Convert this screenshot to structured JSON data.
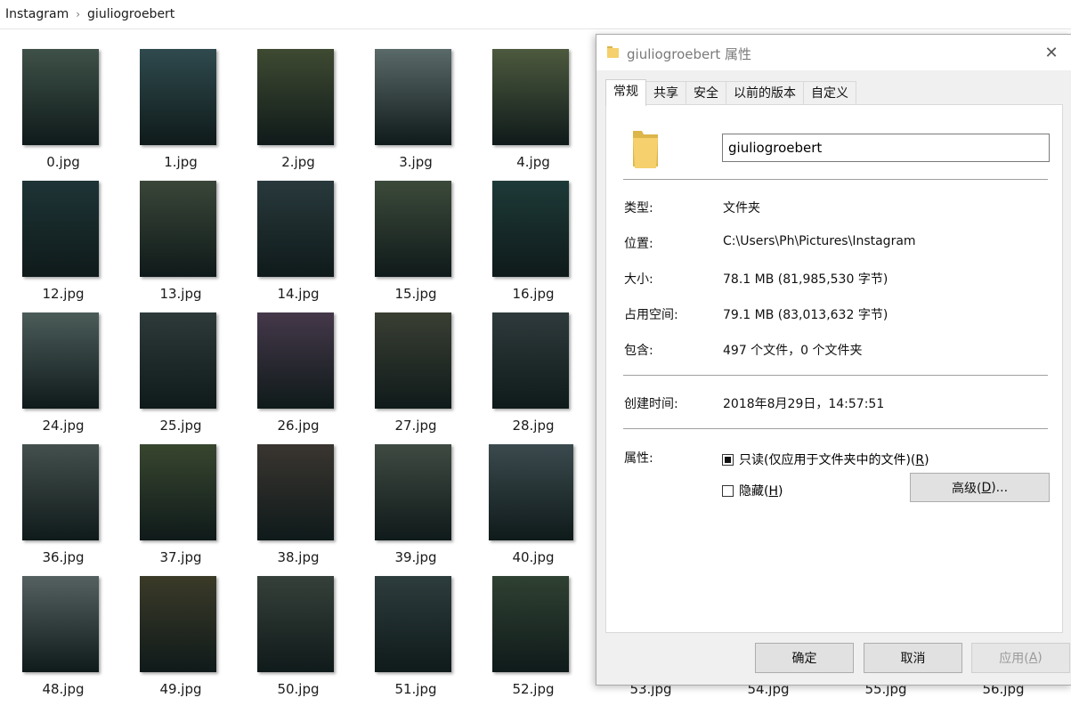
{
  "breadcrumb": {
    "items": [
      "Instagram",
      "giuliogroebert"
    ],
    "separator": "›"
  },
  "files": [
    {
      "name": "0.jpg",
      "tone": "#3e5148"
    },
    {
      "name": "1.jpg",
      "tone": "#2f4a4e"
    },
    {
      "name": "2.jpg",
      "tone": "#3f4a32"
    },
    {
      "name": "3.jpg",
      "tone": "#5a6a68"
    },
    {
      "name": "4.jpg",
      "tone": "#4d5a3e"
    },
    {
      "name": "12.jpg",
      "tone": "#1e3436"
    },
    {
      "name": "13.jpg",
      "tone": "#3a4638"
    },
    {
      "name": "14.jpg",
      "tone": "#29393c"
    },
    {
      "name": "15.jpg",
      "tone": "#3c4a3a"
    },
    {
      "name": "16.jpg",
      "tone": "#1d3a38"
    },
    {
      "name": "24.jpg",
      "tone": "#4b5c59"
    },
    {
      "name": "25.jpg",
      "tone": "#2d3a39"
    },
    {
      "name": "26.jpg",
      "tone": "#45384a"
    },
    {
      "name": "27.jpg",
      "tone": "#3a3f33"
    },
    {
      "name": "28.jpg",
      "tone": "#2e3a3b"
    },
    {
      "name": "36.jpg",
      "tone": "#44504d"
    },
    {
      "name": "37.jpg",
      "tone": "#38462f"
    },
    {
      "name": "38.jpg",
      "tone": "#3a3530"
    },
    {
      "name": "39.jpg",
      "tone": "#3f4a42"
    },
    {
      "name": "40.jpg",
      "tone": "#3b4a4e"
    },
    {
      "name": "48.jpg",
      "tone": "#556060"
    },
    {
      "name": "49.jpg",
      "tone": "#3b3a28"
    },
    {
      "name": "50.jpg",
      "tone": "#36403a"
    },
    {
      "name": "51.jpg",
      "tone": "#2d3c3d"
    },
    {
      "name": "52.jpg",
      "tone": "#2f4132"
    },
    {
      "name": "53.jpg",
      "tone": "#ffffff"
    },
    {
      "name": "54.jpg",
      "tone": "#ffffff"
    },
    {
      "name": "55.jpg",
      "tone": "#ffffff"
    },
    {
      "name": "56.jpg",
      "tone": "#ffffff"
    }
  ],
  "dialog": {
    "title": "giuliogroebert 属性",
    "close_glyph": "✕",
    "tabs": [
      "常规",
      "共享",
      "安全",
      "以前的版本",
      "自定义"
    ],
    "folder_name": "giuliogroebert",
    "props": {
      "type_label": "类型:",
      "type_value": "文件夹",
      "location_label": "位置:",
      "location_value": "C:\\Users\\Ph\\Pictures\\Instagram",
      "size_label": "大小:",
      "size_value": "78.1 MB (81,985,530 字节)",
      "disk_label": "占用空间:",
      "disk_value": "79.1 MB (83,013,632 字节)",
      "contains_label": "包含:",
      "contains_value": "497 个文件，0 个文件夹",
      "created_label": "创建时间:",
      "created_value": "2018年8月29日，14:57:51",
      "attrs_label": "属性:"
    },
    "readonly": {
      "label": "只读(仅应用于文件夹中的文件)(",
      "key": "R",
      "suffix": ")",
      "state": "indeterminate"
    },
    "hidden": {
      "label": "隐藏(",
      "key": "H",
      "suffix": ")",
      "checked": false
    },
    "advanced": {
      "label": "高级(",
      "key": "D",
      "suffix": ")..."
    },
    "buttons": {
      "ok": "确定",
      "cancel": "取消",
      "apply": "应用(",
      "apply_key": "A",
      "apply_suffix": ")"
    }
  },
  "colors": {
    "folder_yellow": "#f5d06c",
    "folder_dark": "#dcb54b",
    "dialog_bg": "#f0f0f0",
    "button_bg": "#e1e1e1"
  }
}
